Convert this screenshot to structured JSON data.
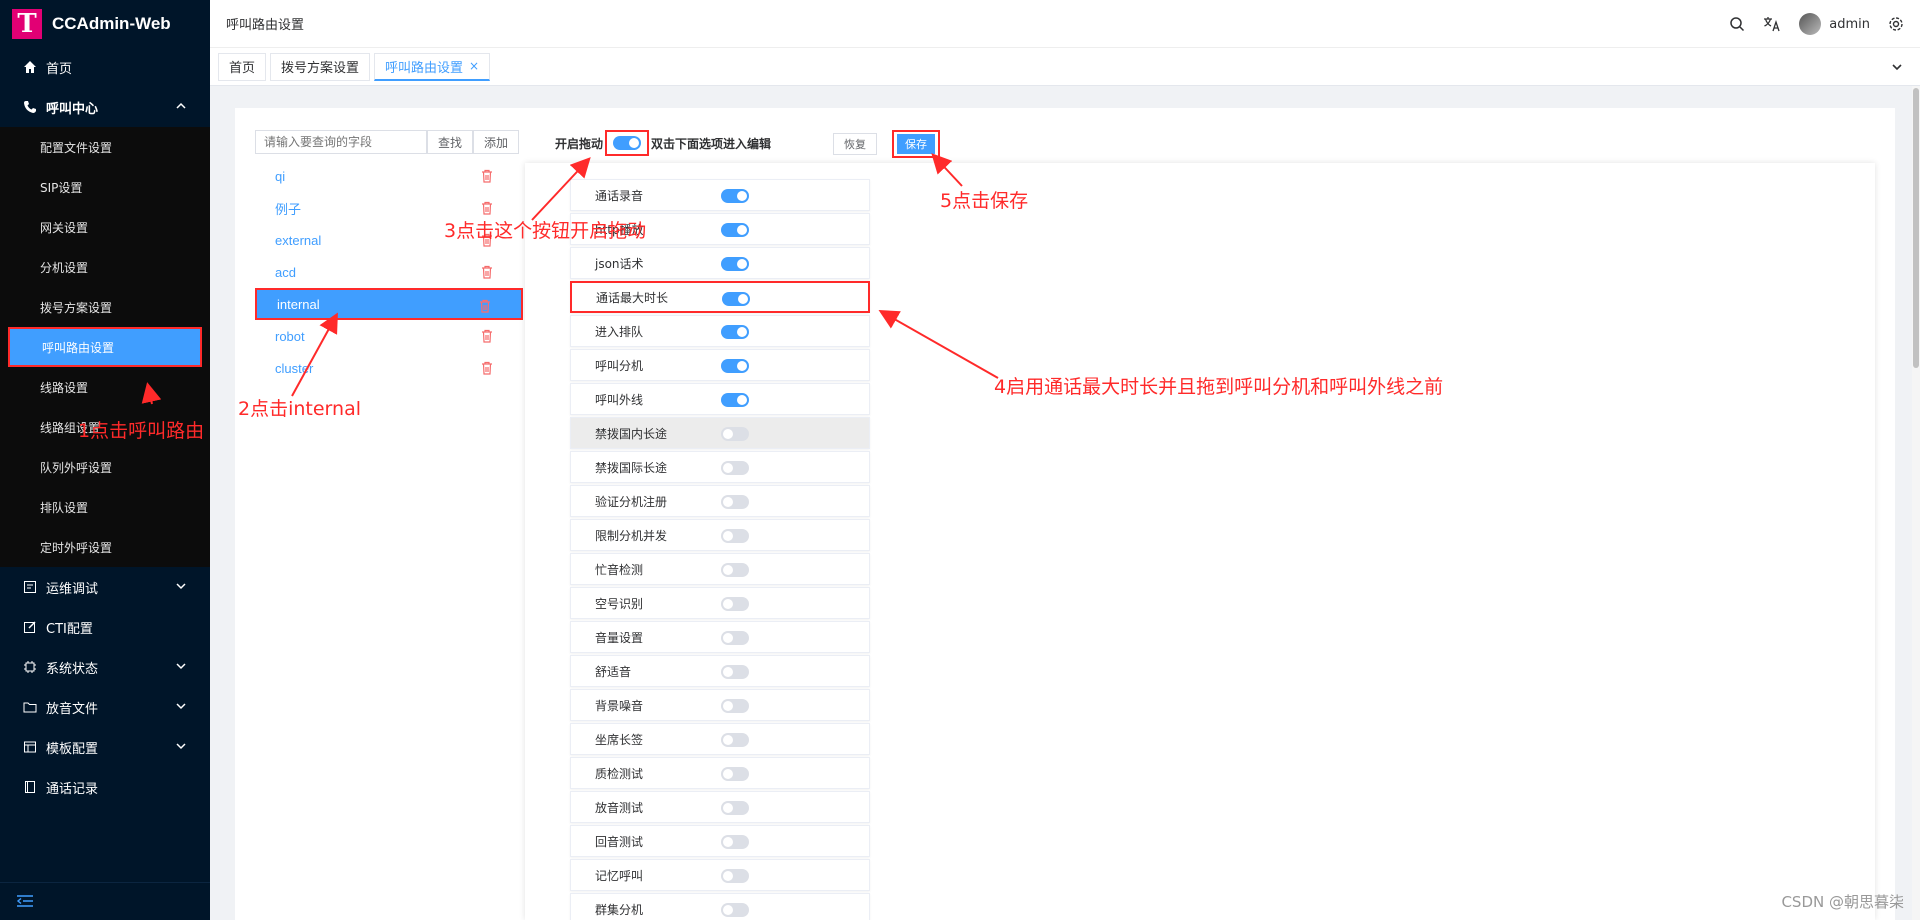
{
  "app": {
    "title": "CCAdmin-Web",
    "logo_letter": "T",
    "brand_color": "#e20074",
    "accent_color": "#409eff"
  },
  "sidebar": {
    "home": "首页",
    "call_center": "呼叫中心",
    "sub_items": [
      "配置文件设置",
      "SIP设置",
      "网关设置",
      "分机设置",
      "拨号方案设置",
      "呼叫路由设置",
      "线路设置",
      "线路组设置",
      "队列外呼设置",
      "排队设置",
      "定时外呼设置"
    ],
    "active_sub": "呼叫路由设置",
    "groups": [
      "运维调试",
      "CTI配置",
      "系统状态",
      "放音文件",
      "模板配置",
      "通话记录"
    ]
  },
  "header": {
    "breadcrumb": "呼叫路由设置",
    "user": "admin"
  },
  "tabs": [
    {
      "label": "首页"
    },
    {
      "label": "拨号方案设置"
    },
    {
      "label": "呼叫路由设置",
      "close": "×"
    }
  ],
  "search": {
    "placeholder": "请输入要查询的字段",
    "search_button": "查找",
    "add_button": "添加"
  },
  "routes": [
    "qi",
    "例子",
    "external",
    "acd",
    "internal",
    "robot",
    "cluster"
  ],
  "active_route": "internal",
  "toolbar": {
    "enable_drag_label": "开启拖动",
    "hint": "双击下面选项进入编辑",
    "restore_button": "恢复",
    "save_button": "保存"
  },
  "options": [
    {
      "label": "通话录音",
      "on": true
    },
    {
      "label": "http播放",
      "on": true
    },
    {
      "label": "json话术",
      "on": true
    },
    {
      "label": "通话最大时长",
      "on": true
    },
    {
      "label": "进入排队",
      "on": true
    },
    {
      "label": "呼叫分机",
      "on": true
    },
    {
      "label": "呼叫外线",
      "on": true
    },
    {
      "label": "禁拨国内长途",
      "on": false
    },
    {
      "label": "禁拨国际长途",
      "on": false
    },
    {
      "label": "验证分机注册",
      "on": false
    },
    {
      "label": "限制分机并发",
      "on": false
    },
    {
      "label": "忙音检测",
      "on": false
    },
    {
      "label": "空号识别",
      "on": false
    },
    {
      "label": "音量设置",
      "on": false
    },
    {
      "label": "舒适音",
      "on": false
    },
    {
      "label": "背景噪音",
      "on": false
    },
    {
      "label": "坐席长签",
      "on": false
    },
    {
      "label": "质检测试",
      "on": false
    },
    {
      "label": "放音测试",
      "on": false
    },
    {
      "label": "回音测试",
      "on": false
    },
    {
      "label": "记忆呼叫",
      "on": false
    },
    {
      "label": "群集分机",
      "on": false
    }
  ],
  "annotations": {
    "step1": "1点击呼叫路由",
    "step2": "2点击internal",
    "step3": "3点击这个按钮开启拖动",
    "step4": "4启用通话最大时长并且拖到呼叫分机和呼叫外线之前",
    "step5": "5点击保存"
  },
  "watermark": "CSDN @朝思暮柒"
}
